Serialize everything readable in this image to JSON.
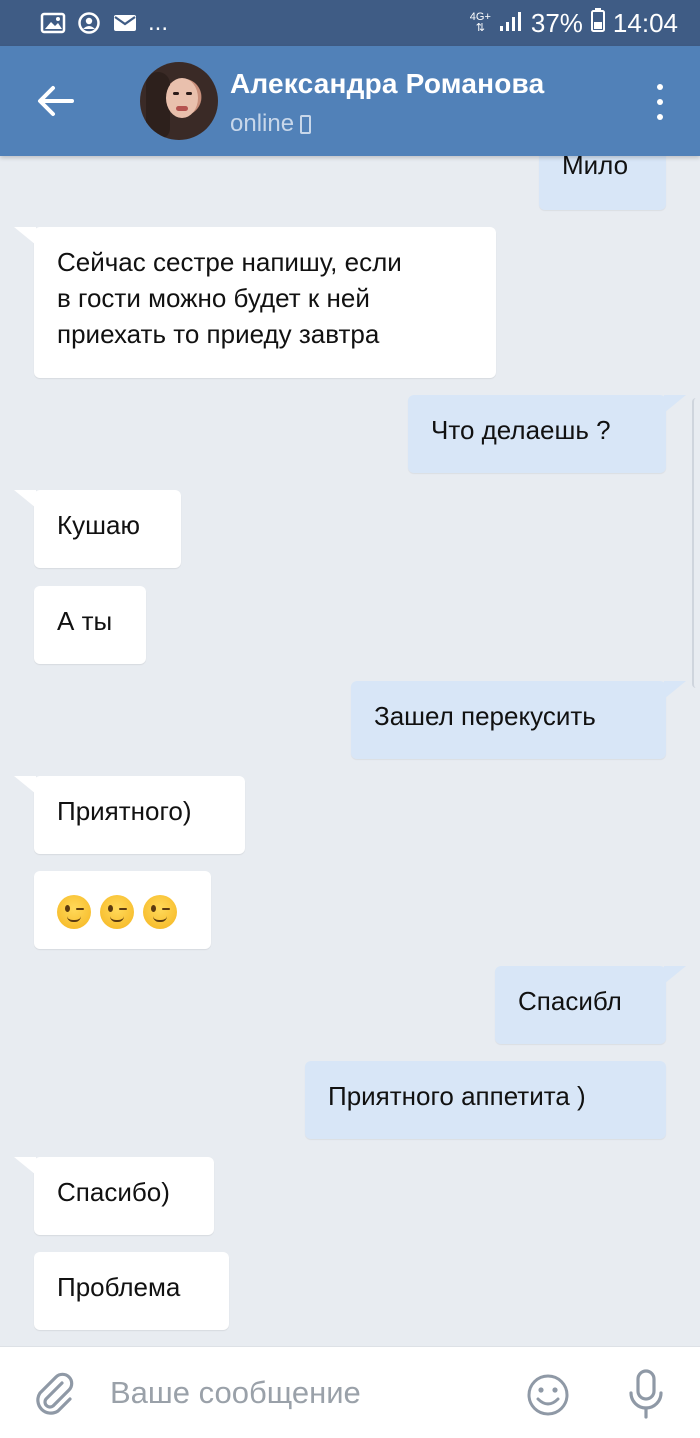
{
  "status_bar": {
    "dots": "...",
    "network": "4G+",
    "battery": "37%",
    "time": "14:04"
  },
  "header": {
    "contact_name": "Александра Романова",
    "contact_status": "online"
  },
  "messages": [
    {
      "direction": "out",
      "text": "Мило"
    },
    {
      "direction": "in",
      "lines": [
        "Сейчас сестре напишу, если",
        "в гости можно будет к ней",
        "приехать то приеду завтра"
      ]
    },
    {
      "direction": "out",
      "text": "Что делаешь ?"
    },
    {
      "direction": "in",
      "text": "Кушаю"
    },
    {
      "direction": "in",
      "text": "А ты"
    },
    {
      "direction": "out",
      "text": "Зашел перекусить"
    },
    {
      "direction": "in",
      "text": "Приятного)"
    },
    {
      "direction": "in",
      "emoji": [
        "wink-emoji",
        "wink-emoji",
        "wink-emoji"
      ]
    },
    {
      "direction": "out",
      "text": "Спасибл"
    },
    {
      "direction": "out",
      "text": "Приятного аппетита )"
    },
    {
      "direction": "in",
      "text": "Спасибо)"
    },
    {
      "direction": "in",
      "text": "Проблема"
    }
  ],
  "compose": {
    "placeholder": "Ваше сообщение",
    "icons": [
      "paperclip-icon",
      "emoji-icon",
      "microphone-icon"
    ]
  },
  "colors": {
    "status_bar": "#3f5c85",
    "header": "#5181b8",
    "background": "#e8ecf1",
    "incoming_bubble": "#ffffff",
    "outgoing_bubble": "#d8e6f7"
  }
}
